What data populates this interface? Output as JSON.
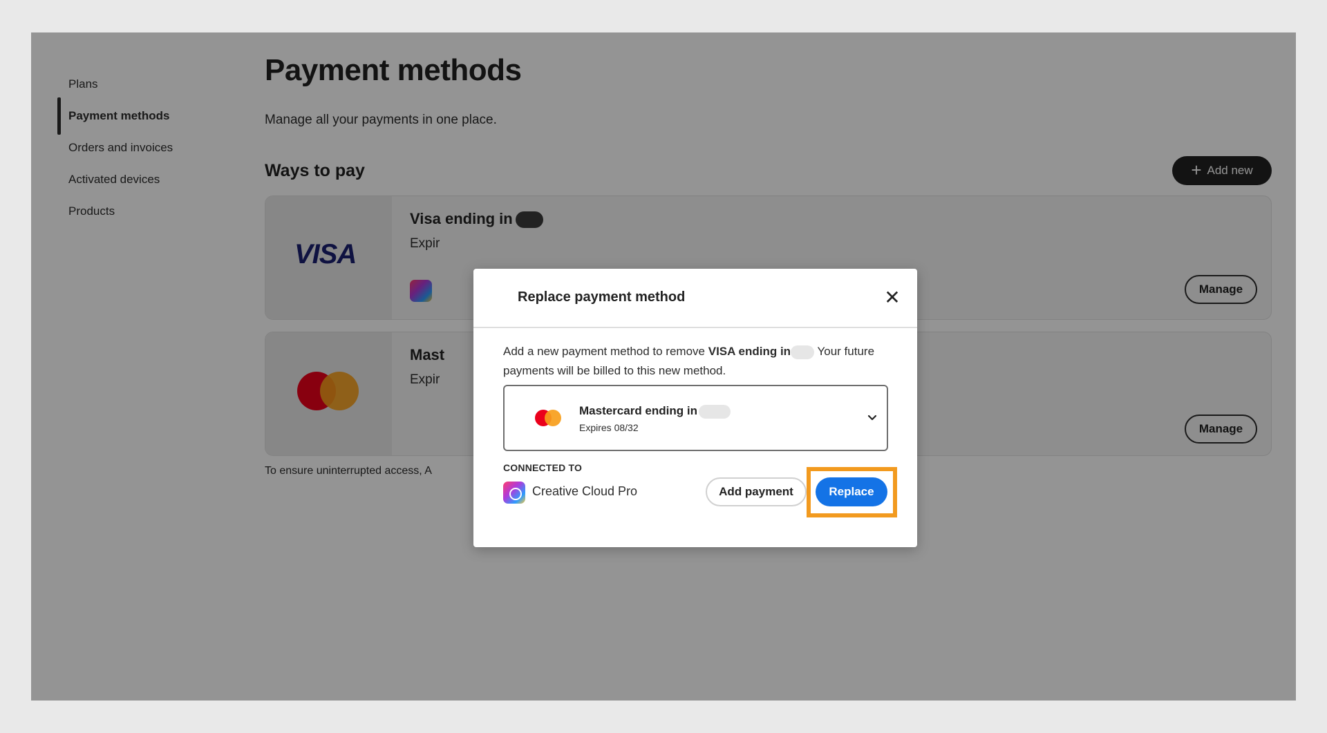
{
  "sidebar": {
    "items": [
      {
        "label": "Plans"
      },
      {
        "label": "Payment methods",
        "active": true
      },
      {
        "label": "Orders and invoices"
      },
      {
        "label": "Activated devices"
      },
      {
        "label": "Products"
      }
    ]
  },
  "page": {
    "title": "Payment methods",
    "subtitle": "Manage all your payments in one place.",
    "section_title": "Ways to pay",
    "add_new_label": "Add new",
    "note": "To ensure uninterrupted access, A"
  },
  "cards": [
    {
      "brand_logo_text": "VISA",
      "title": "Visa ending in",
      "expires_text": "Expir",
      "manage_label": "Manage"
    },
    {
      "title": "Mast",
      "expires_text": "Expir",
      "manage_label": "Manage"
    }
  ],
  "dialog": {
    "title": "Replace payment method",
    "close_icon": "close-icon",
    "body_prefix": "Add a new payment method to remove",
    "body_bold": "VISA ending in",
    "body_suffix": "Your future payments will be billed to this new method.",
    "selected_method": {
      "title": "Mastercard ending in",
      "expires": "Expires 08/32"
    },
    "connected_label": "CONNECTED TO",
    "connected_product": "Creative Cloud Pro",
    "add_payment_label": "Add payment",
    "replace_label": "Replace"
  },
  "colors": {
    "accent": "#1473e6",
    "highlight": "#f29a1f",
    "visa": "#1a1f71",
    "mc_red": "#eb001b",
    "mc_orange": "#f79e1b"
  }
}
